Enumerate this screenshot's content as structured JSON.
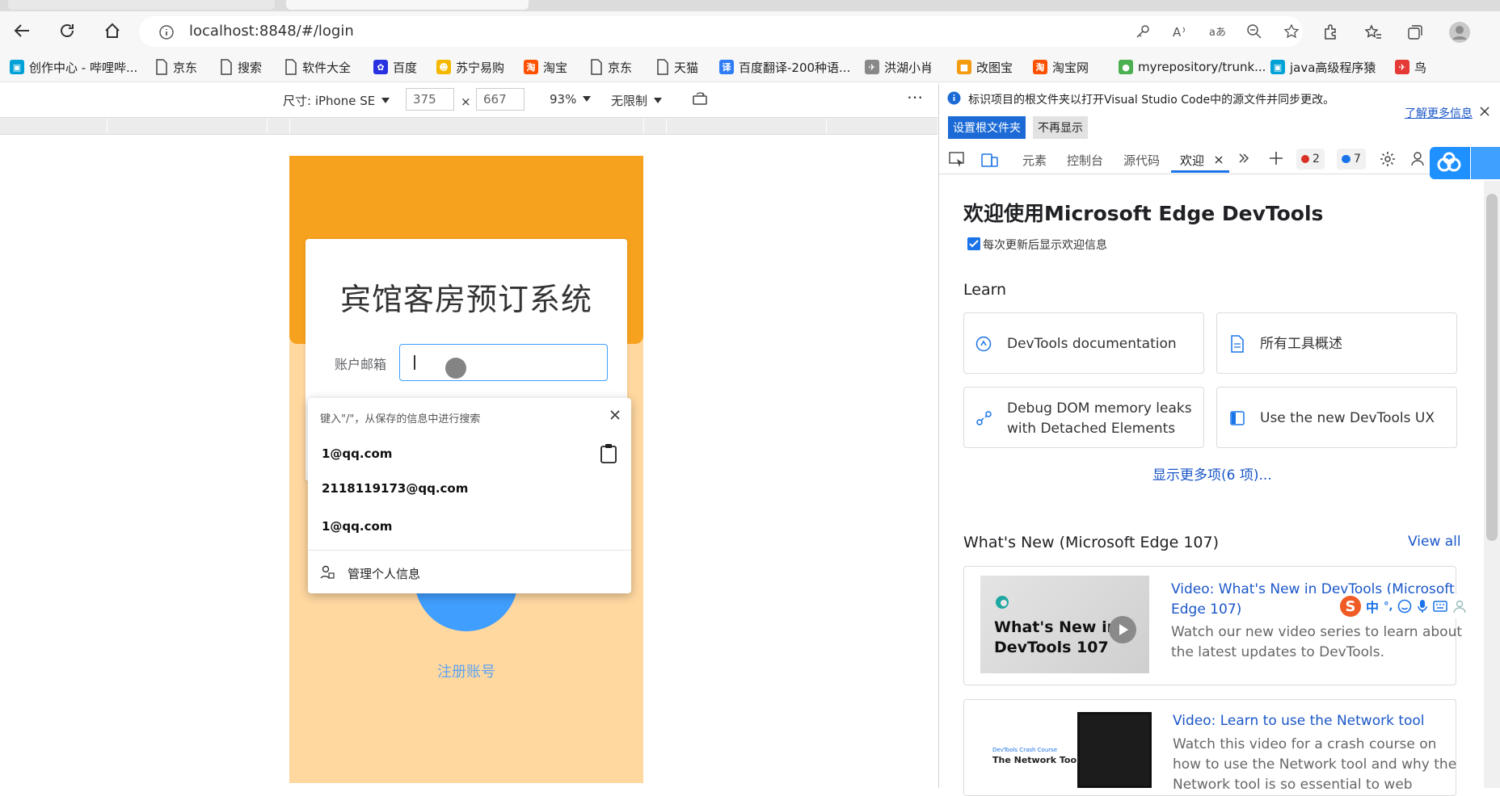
{
  "browser": {
    "url": "localhost:8848/#/login",
    "bookmarks": [
      {
        "label": "创作中心 - 哔哩哔...",
        "icon": "bilibili-icon",
        "color": "#00a1d6"
      },
      {
        "label": "京东",
        "icon": "page-icon"
      },
      {
        "label": "搜索",
        "icon": "page-icon"
      },
      {
        "label": "软件大全",
        "icon": "page-icon"
      },
      {
        "label": "百度",
        "icon": "baidu-icon",
        "color": "#2932e1"
      },
      {
        "label": "苏宁易购",
        "icon": "suning-icon",
        "color": "#f5b800"
      },
      {
        "label": "淘宝",
        "icon": "taobao-icon",
        "color": "#ff5000"
      },
      {
        "label": "京东",
        "icon": "page-icon"
      },
      {
        "label": "天猫",
        "icon": "page-icon"
      },
      {
        "label": "百度翻译-200种语...",
        "icon": "translate-icon",
        "color": "#2f7cf6"
      },
      {
        "label": "洪湖小肖",
        "icon": "bird-icon",
        "color": "#888888"
      },
      {
        "label": "改图宝",
        "icon": "gaitubao-icon",
        "color": "#f39c12"
      },
      {
        "label": "淘宝网",
        "icon": "taobao-icon",
        "color": "#ff5000"
      },
      {
        "label": "myrepository/trunk...",
        "icon": "chrome-icon",
        "color": "#4caf50"
      },
      {
        "label": "java高级程序猿",
        "icon": "bilibili-icon",
        "color": "#00a1d6"
      },
      {
        "label": "鸟",
        "icon": "bird-icon",
        "color": "#e53935"
      }
    ]
  },
  "device_toolbar": {
    "size_label": "尺寸: iPhone SE",
    "width": "375",
    "times": "×",
    "height": "667",
    "zoom": "93%",
    "throttle": "无限制",
    "more": "⋯"
  },
  "app": {
    "title": "宾馆客房预订系统",
    "email_label": "账户邮箱",
    "register_link": "注册账号",
    "colors": {
      "header": "#f7a21f",
      "body": "#ffd8a0",
      "accent": "#409eff"
    }
  },
  "autofill": {
    "hint": "键入\"/\"，从保存的信息中进行搜索",
    "items": [
      "1@qq.com",
      "2118119173@qq.com",
      "1@qq.com"
    ],
    "manage": "管理个人信息"
  },
  "devtools": {
    "info_text": "标识项目的根文件夹以打开Visual Studio Code中的源文件并同步更改。",
    "learn_more": "了解更多信息",
    "btn_set_root": "设置根文件夹",
    "btn_no_show": "不再显示",
    "tabs": [
      "元素",
      "控制台",
      "源代码",
      "欢迎"
    ],
    "errors": "2",
    "messages": "7",
    "welcome_title": "欢迎使用Microsoft Edge DevTools",
    "welcome_check": "每次更新后显示欢迎信息",
    "learn_heading": "Learn",
    "learn_cards": [
      {
        "line1": "DevTools documentation",
        "line2": ""
      },
      {
        "line1": "所有工具概述",
        "line2": ""
      },
      {
        "line1": "Debug DOM memory leaks",
        "line2": "with Detached Elements"
      },
      {
        "line1": "Use the new DevTools UX",
        "line2": ""
      }
    ],
    "show_more": "显示更多项(6 项)...",
    "whats_new": "What's New (Microsoft Edge 107)",
    "view_all": "View all",
    "videos": [
      {
        "thumb_line1": "What's New in",
        "thumb_line2": "DevTools 107",
        "title1": "Video: What's New in DevTools (Microsoft",
        "title2": "Edge 107)",
        "desc1": "Watch our new video series to learn about",
        "desc2": "the latest updates to DevTools."
      },
      {
        "thumb_small": "DevTools Crash Course",
        "thumb_label": "The Network Tool",
        "title1": "Video: Learn to use the Network tool",
        "desc1": "Watch this video for a crash course on",
        "desc2": "how to use the Network tool and why the",
        "desc3": "Network tool is so essential to web"
      }
    ],
    "ime": {
      "brand": "S",
      "mode": "中",
      "punct": "°,"
    }
  }
}
